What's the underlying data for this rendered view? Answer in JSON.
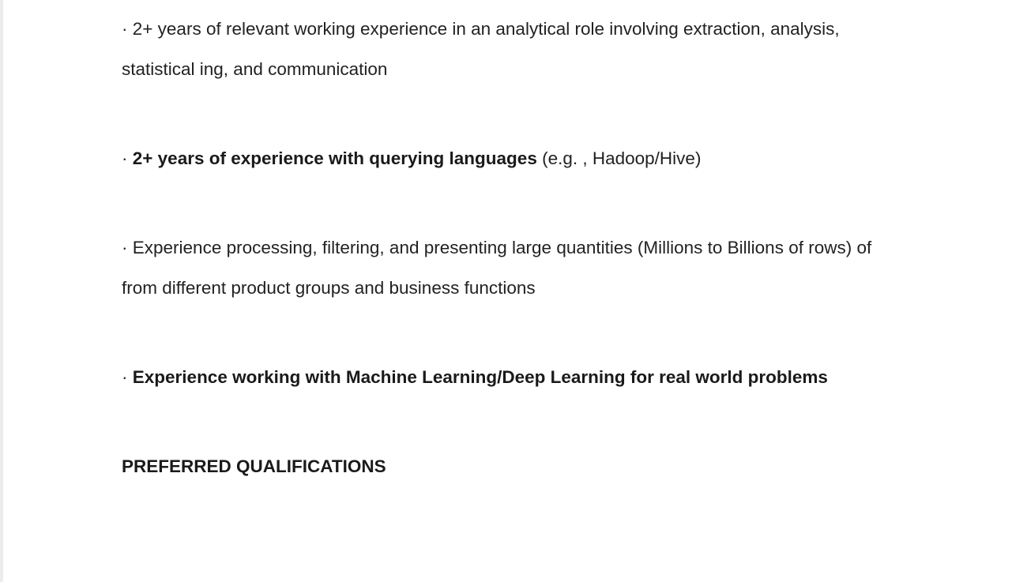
{
  "bullet_char": "·",
  "paragraphs": [
    {
      "plain": "2+ years of relevant working experience in an analytical role involving extraction, analysis, statistical ing, and communication"
    },
    {
      "bold": "2+ years of experience with querying languages",
      "plain": "(e.g. , Hadoop/Hive)"
    },
    {
      "plain": "Experience processing, filtering, and presenting large quantities (Millions to Billions of rows) of from different product groups and business functions"
    },
    {
      "bold": "Experience working with Machine Learning/Deep Learning for real world problems"
    }
  ],
  "heading": "PREFERRED QUALIFICATIONS"
}
